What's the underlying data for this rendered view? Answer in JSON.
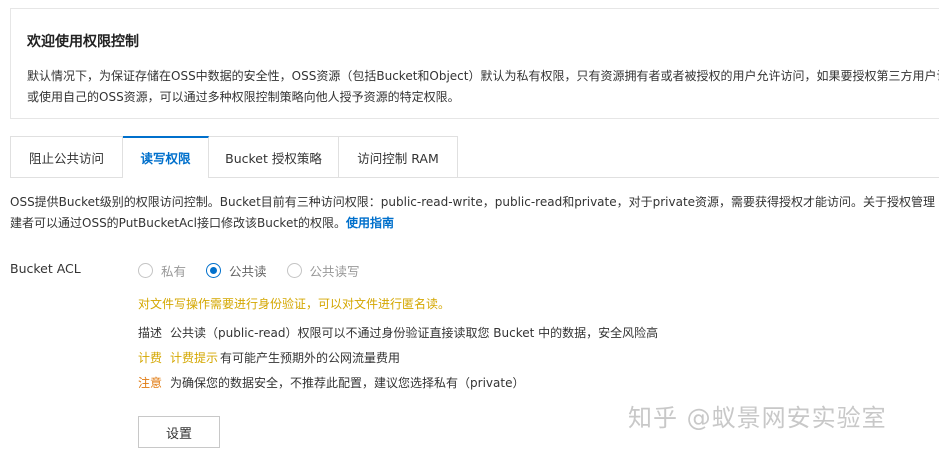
{
  "welcome": {
    "title": "欢迎使用权限控制",
    "desc": "默认情况下，为保证存储在OSS中数据的安全性，OSS资源（包括Bucket和Object）默认为私有权限，只有资源拥有者或者被授权的用户允许访问，如果要授权第三方用户访问或使用自己的OSS资源，可以通过多种权限控制策略向他人授予资源的特定权限。"
  },
  "tabs": [
    {
      "label": "阻止公共访问",
      "active": false
    },
    {
      "label": "读写权限",
      "active": true
    },
    {
      "label": "Bucket 授权策略",
      "active": false
    },
    {
      "label": "访问控制 RAM",
      "active": false
    }
  ],
  "intro": {
    "line1": "OSS提供Bucket级别的权限访问控制。Bucket目前有三种访问权限：public-read-write，public-read和private，对于private资源，需要获得授权才能访问。关于授权管理",
    "line2": "建者可以通过OSS的PutBucketAcl接口修改该Bucket的权限。",
    "link": "使用指南"
  },
  "acl": {
    "label": "Bucket ACL",
    "options": [
      {
        "label": "私有",
        "checked": false
      },
      {
        "label": "公共读",
        "checked": true
      },
      {
        "label": "公共读写",
        "checked": false
      }
    ],
    "warning": "对文件写操作需要进行身份验证，可以对文件进行匿名读。",
    "desc_key": "描述",
    "desc_value": "公共读（public-read）权限可以不通过身份验证直接读取您 Bucket 中的数据，安全风险高",
    "billing_key": "计费",
    "billing_hint": "计费提示",
    "billing_value": "有可能产生预期外的公网流量费用",
    "note_key": "注意",
    "note_value": "为确保您的数据安全，不推荐此配置，建议您选择私有（private）"
  },
  "button": {
    "label": "设置"
  },
  "watermark": "知乎 @蚁景网安实验室",
  "colors": {
    "accent": "#0070cc",
    "warning": "#d4a700",
    "note": "#e07a10"
  }
}
